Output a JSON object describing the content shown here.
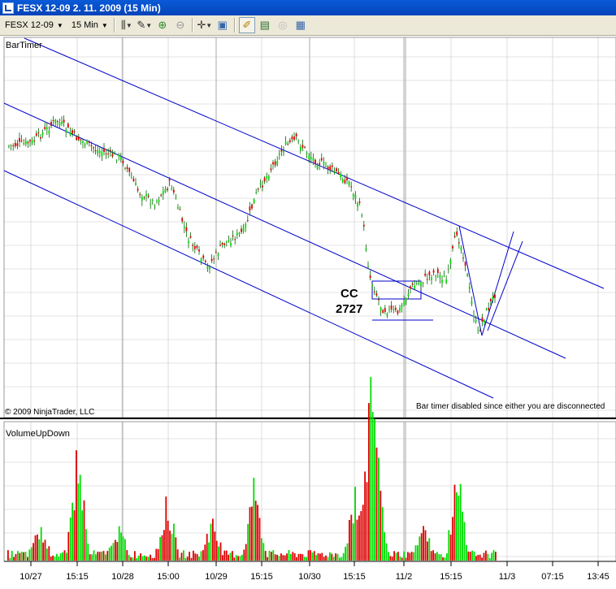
{
  "window": {
    "title": "FESX 12-09  2. 11. 2009 (15 Min)"
  },
  "toolbar": {
    "instrument": "FESX 12-09",
    "interval": "15 Min",
    "buttons": [
      "bar-type-icon",
      "draw-pencil-icon",
      "zoom-in-icon",
      "zoom-out-icon",
      "crosshair-icon",
      "properties-icon",
      "indicators-icon",
      "strategies-icon",
      "disabled-icon",
      "data-box-icon"
    ]
  },
  "price_panel": {
    "indicator_label": "BarTimer",
    "copyright": "© 2009 NinjaTrader, LLC",
    "status_message": "Bar timer disabled since either you are disconnected",
    "annotation_cc": "CC",
    "annotation_value": "2727"
  },
  "volume_panel": {
    "indicator_label": "VolumeUpDown"
  },
  "time_axis": {
    "labels": [
      "10/27",
      "15:15",
      "10/28",
      "15:00",
      "10/29",
      "15:15",
      "10/30",
      "15:15",
      "11/2",
      "15:15",
      "11/3",
      "07:15",
      "13:45"
    ]
  },
  "colors": {
    "up": "#00dd00",
    "down": "#dd0000",
    "channel": "#0000cc",
    "grid": "#c8c8c8",
    "bar": "#006400"
  },
  "chart_data": {
    "type": "candlestick-with-volume",
    "series": [
      {
        "name": "price",
        "values": []
      },
      {
        "name": "volume",
        "values": []
      }
    ]
  }
}
